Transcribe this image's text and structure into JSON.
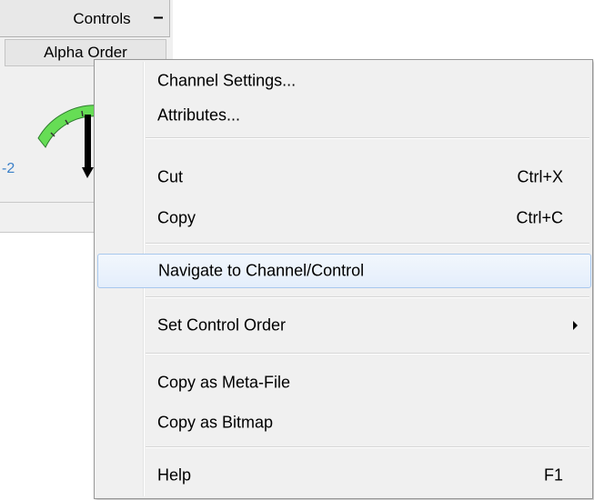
{
  "panel": {
    "title": "Controls",
    "minimize_glyph": "–",
    "order_label": "Alpha Order",
    "gauge_min_label": "-2",
    "colors": {
      "gauge_band": "#66dd55",
      "min_label": "#3a7fc8"
    }
  },
  "menu": {
    "items": [
      {
        "label": "Channel Settings...",
        "shortcut": ""
      },
      {
        "label": "Attributes...",
        "shortcut": ""
      },
      {
        "label": "Cut",
        "shortcut": "Ctrl+X"
      },
      {
        "label": "Copy",
        "shortcut": "Ctrl+C"
      },
      {
        "label": "Navigate to Channel/Control",
        "shortcut": "",
        "highlighted": true
      },
      {
        "label": "Set Control Order",
        "shortcut": "",
        "submenu": true
      },
      {
        "label": "Copy as Meta-File",
        "shortcut": ""
      },
      {
        "label": "Copy as Bitmap",
        "shortcut": ""
      },
      {
        "label": "Help",
        "shortcut": "F1"
      }
    ],
    "colors": {
      "highlight_border": "#a8c8ee",
      "background": "#f0f0f0"
    }
  }
}
